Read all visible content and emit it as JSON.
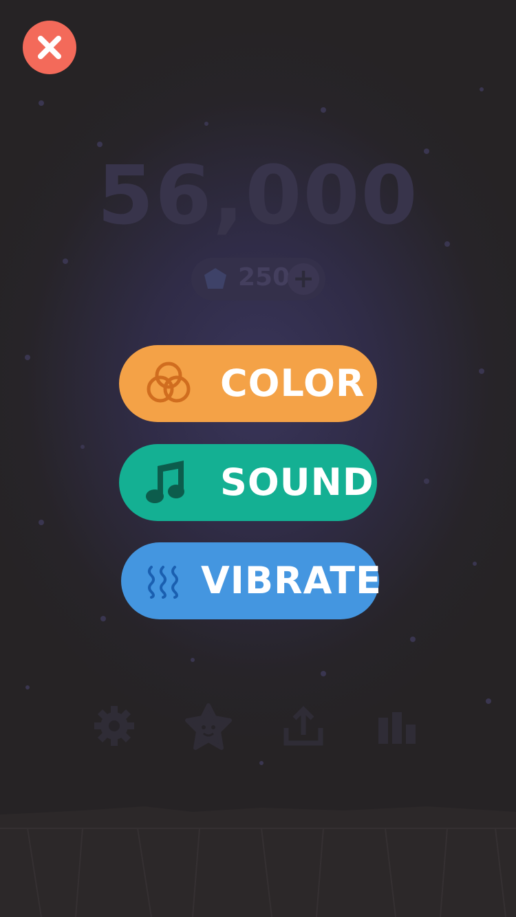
{
  "score": "56,000",
  "gems": {
    "count": "250",
    "add_label": "+"
  },
  "options": {
    "color": {
      "label": "COLOR",
      "icon": "color-circles-icon",
      "bg": "#f4a247"
    },
    "sound": {
      "label": "SOUND",
      "icon": "music-note-icon",
      "bg": "#14b093"
    },
    "vibrate": {
      "label": "VIBRATE",
      "icon": "vibrate-waves-icon",
      "bg": "#4496e0"
    }
  },
  "close": {
    "icon": "close-icon",
    "bg": "#f36a5a"
  },
  "bottom_bar": [
    {
      "icon": "gear-icon"
    },
    {
      "icon": "star-face-icon"
    },
    {
      "icon": "share-icon"
    },
    {
      "icon": "leaderboard-icon"
    }
  ]
}
